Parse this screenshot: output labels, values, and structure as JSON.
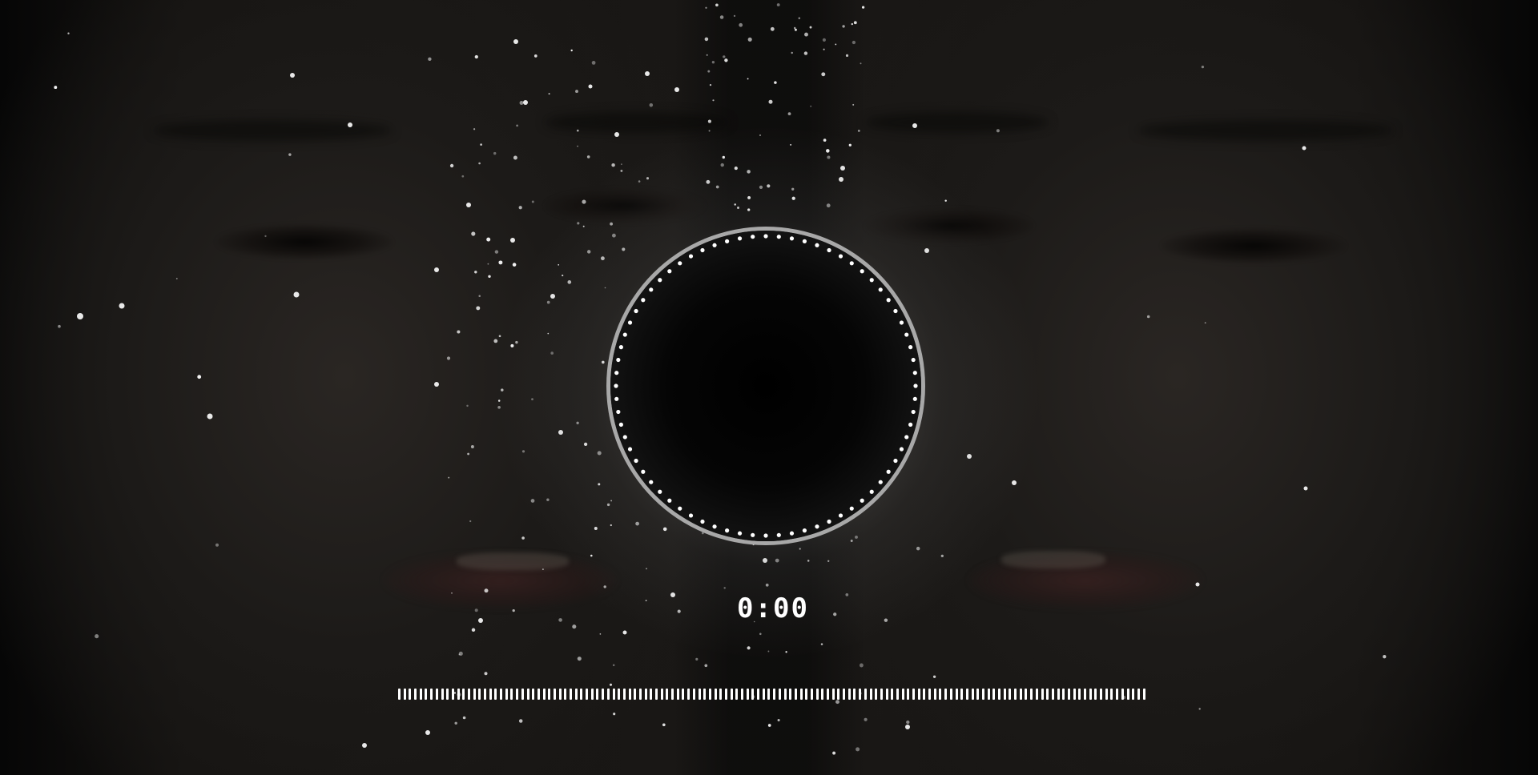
{
  "timer": {
    "elapsed": "0:00"
  },
  "spectrum": {
    "bar_count": 140
  },
  "colors": {
    "background": "#0b0a09",
    "ring_stroke": "#a8a8a8",
    "ring_dots": "#ffffff",
    "particles": "#ffffff",
    "timer_text": "#ffffff",
    "spectrum_bars": "#ffffff"
  }
}
